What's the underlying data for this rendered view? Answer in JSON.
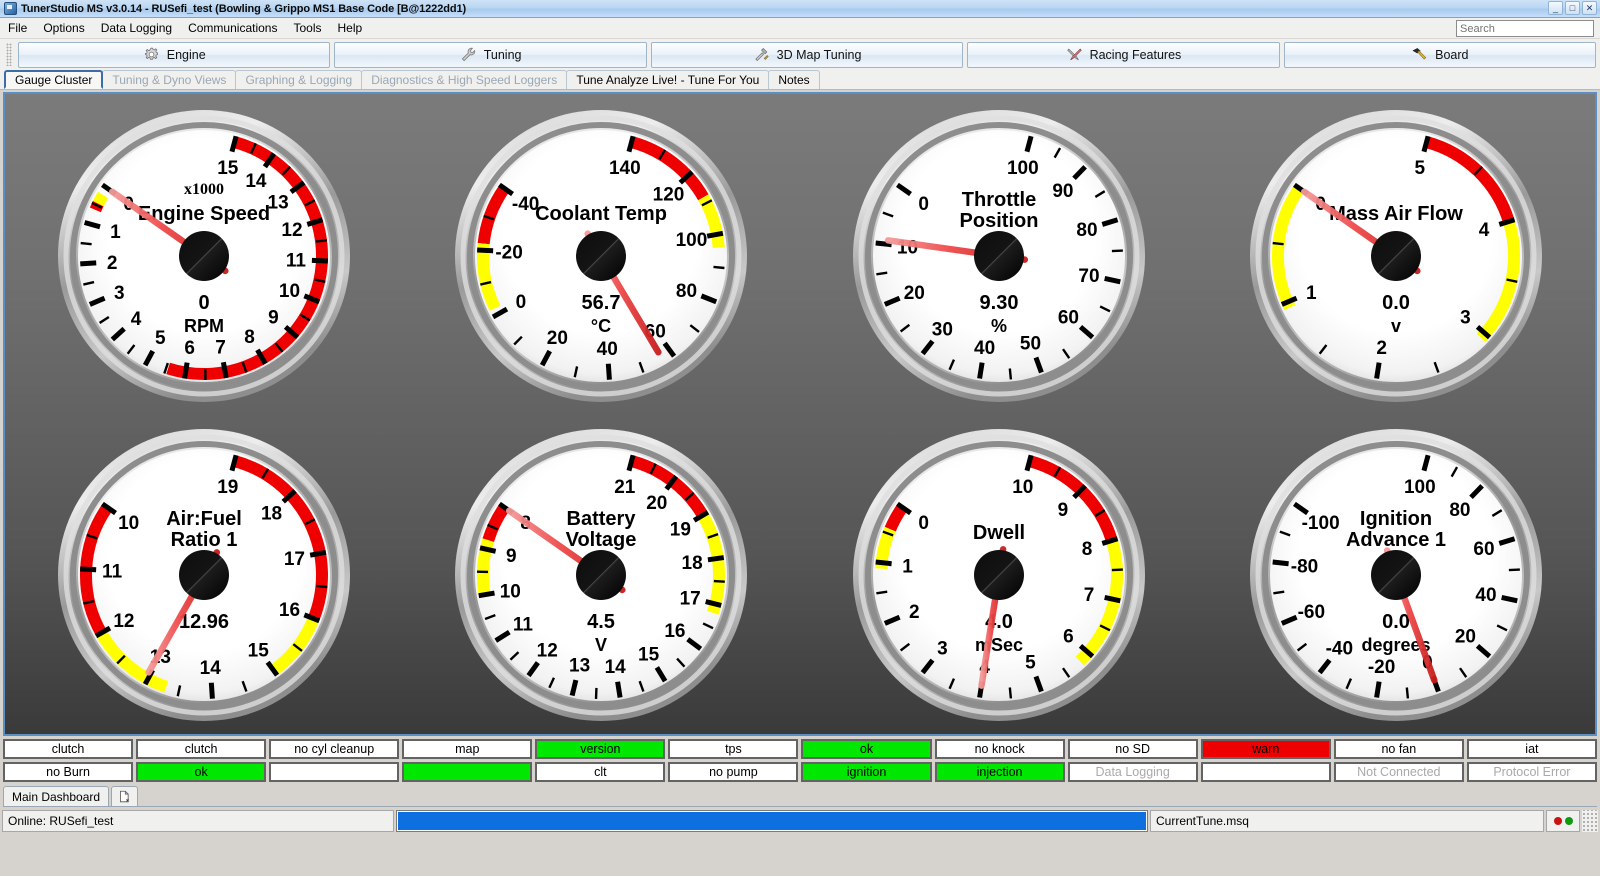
{
  "window": {
    "title": "TunerStudio MS v3.0.14 - RUSefi_test (Bowling & Grippo MS1 Base Code [B@1222dd1)",
    "icon": "app-icon",
    "minimize": "_",
    "maximize": "□",
    "close": "✕"
  },
  "menubar": {
    "items": [
      {
        "label": "File"
      },
      {
        "label": "Options"
      },
      {
        "label": "Data Logging"
      },
      {
        "label": "Communications"
      },
      {
        "label": "Tools"
      },
      {
        "label": "Help"
      }
    ]
  },
  "search": {
    "placeholder": "Search",
    "value": ""
  },
  "toolbar": {
    "buttons": [
      {
        "label": "Engine",
        "icon": "gear-icon"
      },
      {
        "label": "Tuning",
        "icon": "wrench-icon"
      },
      {
        "label": "3D Map Tuning",
        "icon": "wrench-screwdriver-icon"
      },
      {
        "label": "Racing Features",
        "icon": "tools-cross-icon"
      },
      {
        "label": "Board",
        "icon": "hammer-icon"
      }
    ]
  },
  "tabs": [
    {
      "label": "Gauge Cluster",
      "active": true,
      "disabled": false
    },
    {
      "label": "Tuning & Dyno Views",
      "active": false,
      "disabled": true
    },
    {
      "label": "Graphing & Logging",
      "active": false,
      "disabled": true
    },
    {
      "label": "Diagnostics & High Speed Loggers",
      "active": false,
      "disabled": true
    },
    {
      "label": "Tune Analyze Live! - Tune For You",
      "active": false,
      "disabled": false
    },
    {
      "label": "Notes",
      "active": false,
      "disabled": false
    }
  ],
  "colors": {
    "accent": "#3b6ea5",
    "green": "#00e800",
    "red": "#ee0000",
    "yellow": "#ffff00",
    "needle": "#e83030",
    "progress": "#0d6fe0"
  },
  "chart_data": [
    {
      "type": "gauge",
      "title": "Engine Speed",
      "subtitle": "x1000",
      "value": 0,
      "value_text": "0",
      "units": "RPM",
      "min": 0,
      "max": 15,
      "tick_labels": [
        0,
        1,
        2,
        3,
        4,
        5,
        6,
        7,
        8,
        9,
        10,
        11,
        12,
        13,
        14,
        15
      ],
      "major_step": 1,
      "minor_per_major": 2,
      "zones": [
        {
          "from": 0.2,
          "to": 0.45,
          "color": "#ffff00"
        },
        {
          "from": 0.45,
          "to": 0.62,
          "color": "#ee0000"
        },
        {
          "from": 5.55,
          "to": 15,
          "color": "#ee0000"
        }
      ]
    },
    {
      "type": "gauge",
      "title": "Coolant Temp",
      "subtitle": "",
      "value": 56.7,
      "value_text": "56.7",
      "units": "°C",
      "min": -40,
      "max": 140,
      "tick_labels": [
        -40,
        -20,
        0,
        20,
        40,
        60,
        80,
        100,
        120,
        140
      ],
      "major_step": 20,
      "minor_per_major": 2,
      "zones": [
        {
          "from": -40,
          "to": -22,
          "color": "#ee0000"
        },
        {
          "from": -22,
          "to": -2,
          "color": "#ffff00"
        },
        {
          "from": 96,
          "to": 112,
          "color": "#ffff00"
        },
        {
          "from": 112,
          "to": 140,
          "color": "#ee0000"
        }
      ]
    },
    {
      "type": "gauge",
      "title": "Throttle Position",
      "subtitle": "",
      "value": 9.3,
      "value_text": "9.30",
      "units": "%",
      "min": 0,
      "max": 100,
      "tick_labels": [
        0,
        10,
        20,
        30,
        40,
        50,
        60,
        70,
        80,
        90,
        100
      ],
      "major_step": 10,
      "minor_per_major": 2,
      "zones": []
    },
    {
      "type": "gauge",
      "title": "Mass Air Flow",
      "subtitle": "",
      "value": 0,
      "value_text": "0.0",
      "units": "v",
      "min": 0,
      "max": 5,
      "tick_labels": [
        0,
        1,
        2,
        3,
        4,
        5
      ],
      "major_step": 1,
      "minor_per_major": 2,
      "zones": [
        {
          "from": 0,
          "to": 1.05,
          "color": "#ffff00"
        },
        {
          "from": 2.95,
          "to": 4,
          "color": "#ffff00"
        },
        {
          "from": 4,
          "to": 5,
          "color": "#ee0000"
        }
      ]
    },
    {
      "type": "gauge",
      "title": "Air:Fuel Ratio 1",
      "subtitle": "",
      "value": 12.96,
      "value_text": "12.96",
      "units": "",
      "min": 10,
      "max": 19,
      "tick_labels": [
        10,
        11,
        12,
        13,
        14,
        15,
        16,
        17,
        18,
        19
      ],
      "major_step": 1,
      "minor_per_major": 2,
      "zones": [
        {
          "from": 10,
          "to": 12.0,
          "color": "#ee0000"
        },
        {
          "from": 12.0,
          "to": 13.3,
          "color": "#ffff00"
        },
        {
          "from": 15.0,
          "to": 16.0,
          "color": "#ffff00"
        },
        {
          "from": 16.0,
          "to": 19,
          "color": "#ee0000"
        }
      ]
    },
    {
      "type": "gauge",
      "title": "Battery Voltage",
      "subtitle": "",
      "value": 4.5,
      "value_text": "4.5",
      "units": "V",
      "min": 8,
      "max": 21,
      "tick_labels": [
        8,
        9,
        10,
        11,
        12,
        13,
        14,
        15,
        16,
        17,
        18,
        19,
        20,
        21
      ],
      "major_step": 1,
      "minor_per_major": 2,
      "zones": [
        {
          "from": 8,
          "to": 8.8,
          "color": "#ee0000"
        },
        {
          "from": 8.8,
          "to": 10.05,
          "color": "#ffff00"
        },
        {
          "from": 16.8,
          "to": 19.05,
          "color": "#ffff00"
        },
        {
          "from": 19.05,
          "to": 21,
          "color": "#ee0000"
        }
      ]
    },
    {
      "type": "gauge",
      "title": "Dwell",
      "subtitle": "",
      "value": 4.0,
      "value_text": "4.0",
      "units": "mSec",
      "min": 0,
      "max": 10,
      "tick_labels": [
        0,
        1,
        2,
        3,
        4,
        5,
        6,
        7,
        8,
        9,
        10
      ],
      "major_step": 1,
      "minor_per_major": 2,
      "zones": [
        {
          "from": 0,
          "to": 0.42,
          "color": "#ee0000"
        },
        {
          "from": 0.42,
          "to": 1.1,
          "color": "#ffff00"
        },
        {
          "from": 5.8,
          "to": 8.0,
          "color": "#ffff00"
        },
        {
          "from": 8.0,
          "to": 10,
          "color": "#ee0000"
        }
      ]
    },
    {
      "type": "gauge",
      "title": "Ignition Advance 1",
      "subtitle": "",
      "value": 0,
      "value_text": "0.0",
      "units": "degrees",
      "min": -100,
      "max": 100,
      "tick_labels": [
        -100,
        -80,
        -60,
        -40,
        -20,
        0,
        20,
        40,
        60,
        80,
        100
      ],
      "major_step": 20,
      "minor_per_major": 2,
      "zones": []
    }
  ],
  "indicators": {
    "row1": [
      {
        "label": "clutch",
        "state": "off"
      },
      {
        "label": "clutch",
        "state": "off"
      },
      {
        "label": "no cyl cleanup",
        "state": "off"
      },
      {
        "label": "map",
        "state": "off"
      },
      {
        "label": "version",
        "state": "green"
      },
      {
        "label": "tps",
        "state": "off"
      },
      {
        "label": "ok",
        "state": "green"
      },
      {
        "label": "no knock",
        "state": "off"
      },
      {
        "label": "no SD",
        "state": "off"
      },
      {
        "label": "warn",
        "state": "red"
      },
      {
        "label": "no fan",
        "state": "off"
      },
      {
        "label": "iat",
        "state": "off"
      }
    ],
    "row2": [
      {
        "label": "no Burn",
        "state": "off"
      },
      {
        "label": "ok",
        "state": "green"
      },
      {
        "label": "",
        "state": "off"
      },
      {
        "label": "",
        "state": "green"
      },
      {
        "label": "clt",
        "state": "off"
      },
      {
        "label": "no pump",
        "state": "off"
      },
      {
        "label": "ignition",
        "state": "green"
      },
      {
        "label": "injection",
        "state": "green"
      },
      {
        "label": "Data Logging",
        "state": "disabled"
      },
      {
        "label": "",
        "state": "off"
      },
      {
        "label": "Not Connected",
        "state": "disabled"
      },
      {
        "label": "Protocol Error",
        "state": "disabled"
      }
    ]
  },
  "dashboard_tabs": [
    {
      "label": "Main Dashboard",
      "icon": ""
    },
    {
      "label": "",
      "icon": "new-page-icon"
    }
  ],
  "statusbar": {
    "online": "Online: RUSefi_test",
    "progress_percent": 100,
    "file": "CurrentTune.msq",
    "led_red": "#cc1111",
    "led_green": "#119911"
  }
}
